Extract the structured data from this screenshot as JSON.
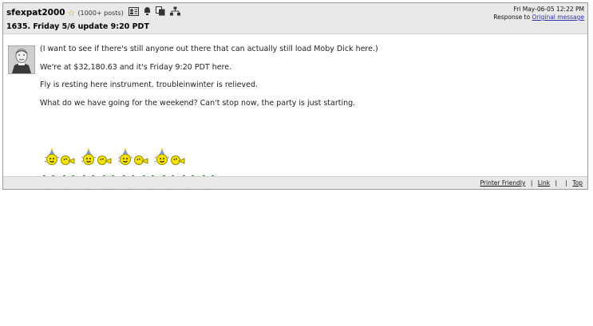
{
  "post": {
    "username": "sfexpat2000",
    "post_count": "(1000+ posts)",
    "subject": "1635. Friday 5/6 update 9:20 PDT",
    "date": "Fri May-06-05 12:22 PM",
    "response_prefix": "Response to",
    "original_link": "Original message",
    "icons": [
      "star-icon",
      "profile-icon",
      "alert-icon",
      "copy-icon",
      "sitemap-icon"
    ],
    "messages": [
      "(I want to see if there's still anyone out there that can actually still load Moby Dick here.)",
      "We're at $32,180.63 and it's Friday 9:20 PDT here.",
      "Fly is resting here instrument. troubleinwinter is relieved.",
      "What do we have going for the weekend? Can't stop now, the party is just starting."
    ],
    "smiley_pairs": 4,
    "frog_count": 9
  },
  "footer": {
    "printer_friendly": "Printer Friendly",
    "sep": "|",
    "link": "Link",
    "top": "Top"
  }
}
